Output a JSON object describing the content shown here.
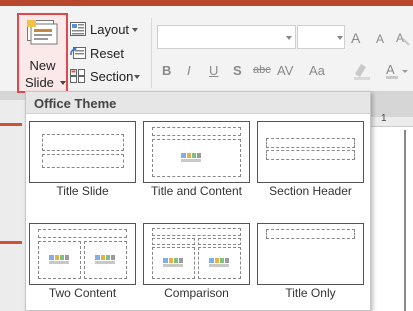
{
  "ribbon": {
    "new_slide_line1": "New",
    "new_slide_line2": "Slide",
    "layout_label": "Layout",
    "reset_label": "Reset",
    "section_label": "Section",
    "format_bold": "B",
    "format_italic": "I",
    "format_underline": "U",
    "format_shadow": "S",
    "format_strikethrough": "abc",
    "format_spacing": "AV",
    "format_case": "Aa",
    "grow_font": "A",
    "shrink_font": "A"
  },
  "dropdown": {
    "header": "Office Theme",
    "layouts": [
      {
        "label": "Title Slide"
      },
      {
        "label": "Title and Content"
      },
      {
        "label": "Section Header"
      },
      {
        "label": "Two Content"
      },
      {
        "label": "Comparison"
      },
      {
        "label": "Title Only"
      }
    ]
  },
  "ruler": {
    "text": "1"
  },
  "colors": {
    "accent": "#b7472a",
    "highlight_border": "#e0484b"
  },
  "icons": [
    "new-slide-icon",
    "layout-icon",
    "reset-icon",
    "section-icon",
    "caret-down-icon",
    "clear-format-icon"
  ]
}
